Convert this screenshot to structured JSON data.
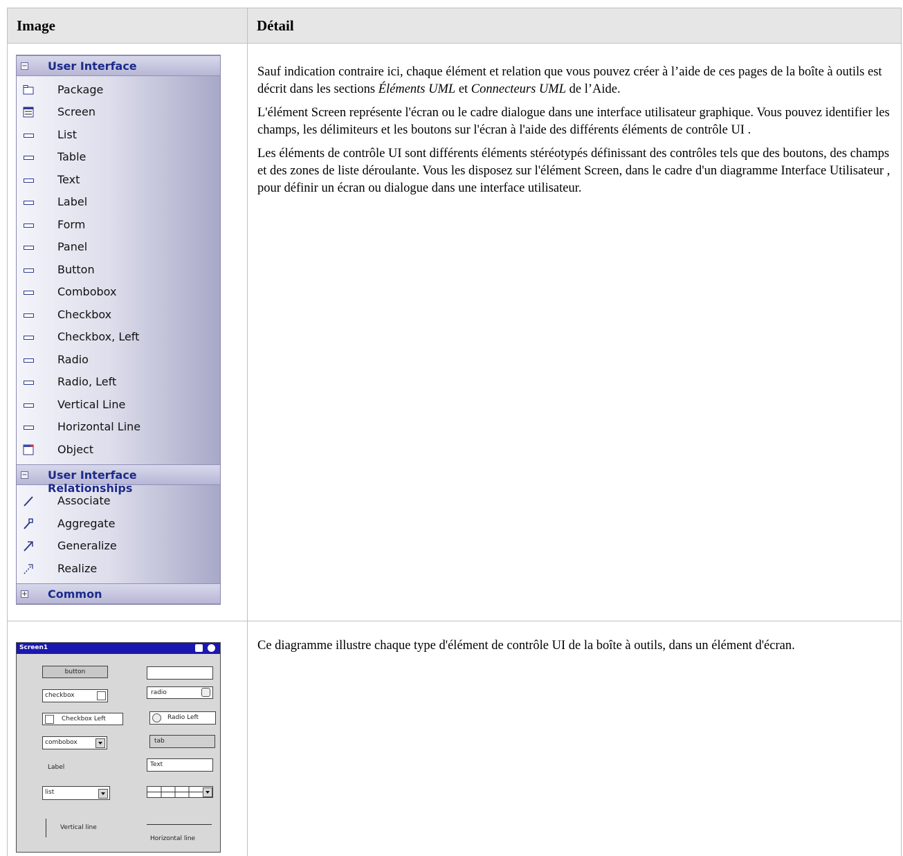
{
  "table": {
    "headers": [
      "Image",
      "Détail"
    ]
  },
  "toolbox": {
    "sections": [
      {
        "title": "User Interface",
        "expanded_sign": "−",
        "items": [
          {
            "label": "Package",
            "icon": "package-icon"
          },
          {
            "label": "Screen",
            "icon": "screen-icon"
          },
          {
            "label": "List",
            "icon": "control-icon"
          },
          {
            "label": "Table",
            "icon": "control-icon"
          },
          {
            "label": "Text",
            "icon": "control-icon"
          },
          {
            "label": "Label",
            "icon": "control-icon"
          },
          {
            "label": "Form",
            "icon": "control-icon"
          },
          {
            "label": "Panel",
            "icon": "control-icon"
          },
          {
            "label": "Button",
            "icon": "control-icon"
          },
          {
            "label": "Combobox",
            "icon": "control-icon"
          },
          {
            "label": "Checkbox",
            "icon": "control-icon"
          },
          {
            "label": "Checkbox, Left",
            "icon": "control-icon"
          },
          {
            "label": "Radio",
            "icon": "control-icon"
          },
          {
            "label": "Radio, Left",
            "icon": "control-icon"
          },
          {
            "label": "Vertical Line",
            "icon": "control-icon"
          },
          {
            "label": "Horizontal Line",
            "icon": "control-icon"
          },
          {
            "label": "Object",
            "icon": "object-icon"
          }
        ]
      },
      {
        "title": "User Interface Relationships",
        "expanded_sign": "−",
        "items": [
          {
            "label": "Associate",
            "icon": "associate-icon"
          },
          {
            "label": "Aggregate",
            "icon": "aggregate-icon"
          },
          {
            "label": "Generalize",
            "icon": "generalize-icon"
          },
          {
            "label": "Realize",
            "icon": "realize-icon"
          }
        ]
      },
      {
        "title": "Common",
        "expanded_sign": "+",
        "items": []
      }
    ]
  },
  "detail_row1": {
    "p1_part1": "Sauf indication contraire ici, chaque élément et relation que vous pouvez créer à l’aide de ces pages de la boîte à outils est décrit dans les sections ",
    "p1_em1": "Éléments UML",
    "p1_part2": " et ",
    "p1_em2": "Connecteurs UML",
    "p1_part3": " de l’Aide.",
    "p2": "L'élément Screen représente l'écran ou le cadre dialogue dans une interface utilisateur graphique. Vous pouvez identifier les champs, les délimiteurs et les boutons sur l'écran à l'aide des différents éléments de contrôle UI .",
    "p3": "Les éléments de contrôle UI sont différents éléments stéréotypés définissant des contrôles tels que des boutons, des champs et des zones de liste déroulante. Vous les disposez sur l'élément Screen, dans le cadre d'un diagramme Interface Utilisateur , pour définir un écran ou dialogue dans une interface utilisateur."
  },
  "detail_row2": {
    "p1": "Ce diagramme illustre chaque type d'élément de contrôle UI de la boîte à outils, dans un élément d'écran."
  },
  "screen_mock": {
    "title": "Screen1",
    "button": "button",
    "checkbox": "checkbox",
    "checkbox_left": "Checkbox Left",
    "combobox": "combobox",
    "label": "Label",
    "list": "list",
    "vertical_line": "Vertical line",
    "radio": "radio",
    "radio_left": "Radio Left",
    "tab": "tab",
    "text": "Text",
    "horizontal_line": "Horizontal line"
  }
}
